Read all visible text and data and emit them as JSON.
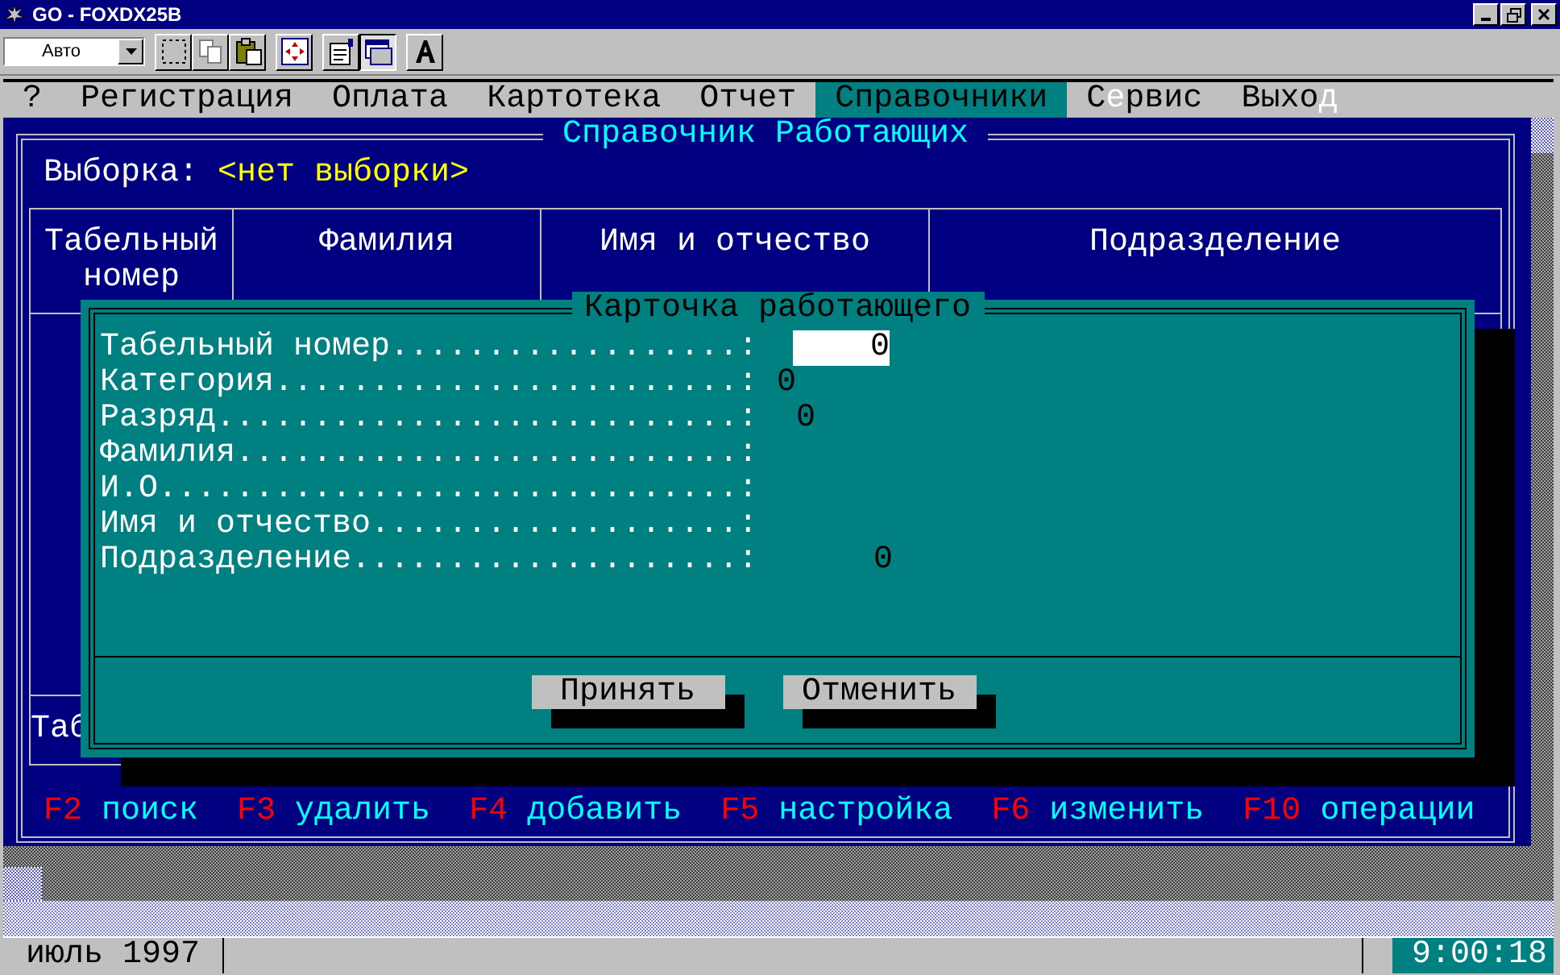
{
  "window": {
    "title": "GO - FOXDX25B"
  },
  "toolbar": {
    "dropdown_value": "Авто",
    "buttons": [
      {
        "pressed": false
      },
      {
        "pressed": false
      },
      {
        "pressed": false
      },
      {
        "pressed": false
      },
      {
        "pressed": false
      },
      {
        "pressed": true
      },
      {
        "pressed": false
      }
    ]
  },
  "menu": [
    {
      "label": "?",
      "selected": false
    },
    {
      "label": "Регистрация",
      "selected": false
    },
    {
      "label": "Оплата",
      "selected": false
    },
    {
      "label": "Картотека",
      "selected": false
    },
    {
      "label": "Отчет",
      "selected": false
    },
    {
      "label": "Справочники",
      "selected": true
    },
    {
      "label": "С",
      "hotkey": "е",
      "label_end": "рвис",
      "selected": false
    },
    {
      "label": "Выхо",
      "hotkey": "д",
      "selected": false
    }
  ],
  "panel": {
    "title": "Справочник Работающих",
    "filter_label": "Выборка:",
    "filter_value": "<нет выборки>",
    "columns": [
      "Табельный номер",
      "Фамилия",
      "Имя и отчество",
      "Подразделение"
    ],
    "footer_text": "Таб",
    "function_keys": [
      {
        "key": "F2",
        "action": "поиск"
      },
      {
        "key": "F3",
        "action": "удалить"
      },
      {
        "key": "F4",
        "action": "добавить"
      },
      {
        "key": "F5",
        "action": "настройка"
      },
      {
        "key": "F6",
        "action": "изменить"
      },
      {
        "key": "F10",
        "action": "операции"
      }
    ]
  },
  "dialog": {
    "title": "Карточка работающего",
    "fields": [
      {
        "label": "Табельный номер..................:",
        "value": "0",
        "kind": "input"
      },
      {
        "label": "Категория........................:",
        "value": "0",
        "kind": "text"
      },
      {
        "label": "Разряд...........................:",
        "value": "0",
        "kind": "text"
      },
      {
        "label": "Фамилия..........................:",
        "kind": "text"
      },
      {
        "label": "И.О..............................:",
        "kind": "text"
      },
      {
        "label": "Имя и отчество...................:",
        "kind": "text"
      },
      {
        "label": "Подразделение....................:",
        "value": "0",
        "kind": "text"
      }
    ],
    "buttons": [
      "Принять",
      "Отменить"
    ]
  },
  "status_bar": {
    "period": "июль 1997",
    "clock": "9:00:18"
  }
}
